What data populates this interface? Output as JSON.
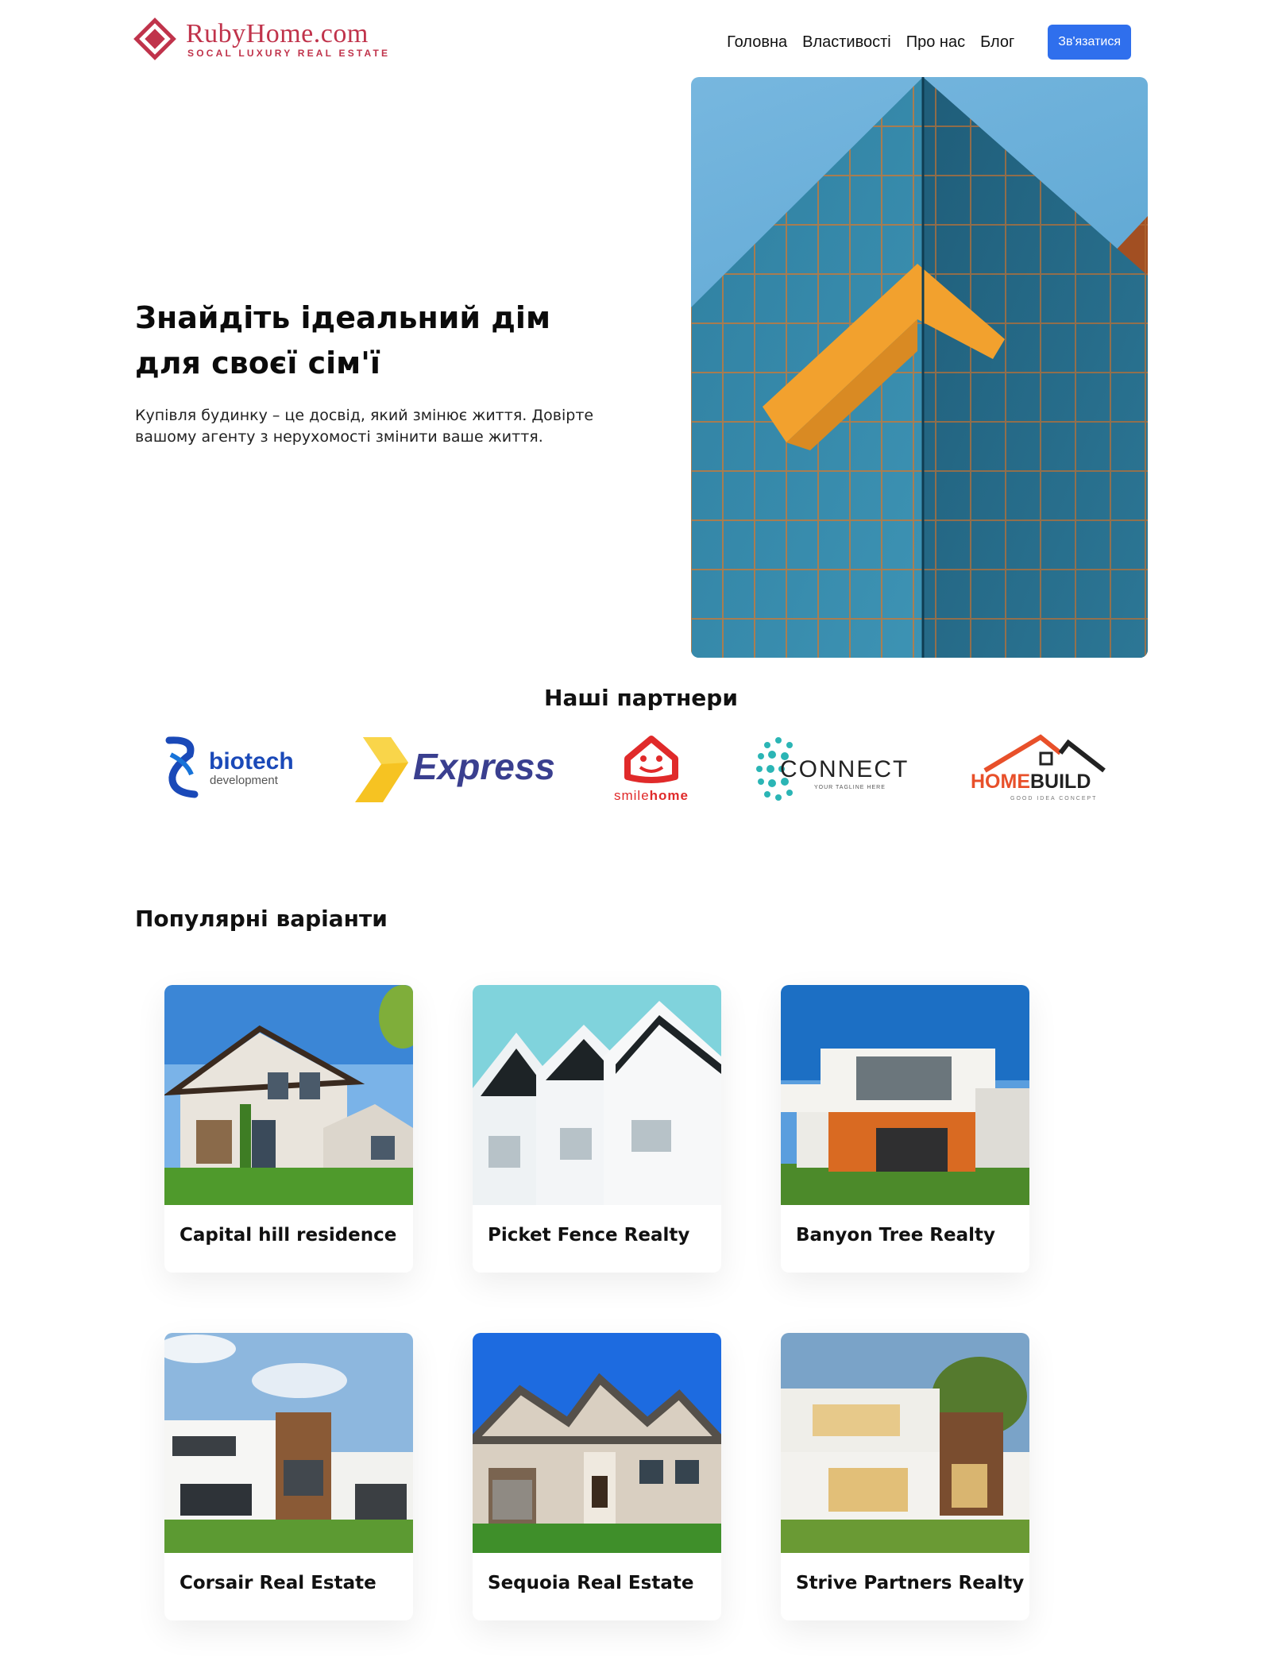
{
  "brand": {
    "name": "RubyHome.com",
    "tagline": "SOCAL LUXURY REAL ESTATE",
    "color": "#c0334b"
  },
  "nav": {
    "items": [
      "Головна",
      "Властивості",
      "Про нас",
      "Блог"
    ],
    "cta": "Зв'язатися",
    "cta_color": "#2f6fed"
  },
  "hero": {
    "title": "Знайдіть ідеальний дім для своєї сім'ї",
    "subtitle": "Купівля будинку – це досвід, який змінює життя. Довірте вашому агенту з нерухомості змінити ваше життя."
  },
  "partners": {
    "title": "Наші партнери",
    "logos": [
      {
        "name": "biotech development",
        "text_main": "biotech",
        "text_sub": "development"
      },
      {
        "name": "Express",
        "text_main": "Express"
      },
      {
        "name": "smilehome",
        "text_main": "smile",
        "text_accent": "home"
      },
      {
        "name": "CONNECT",
        "text_main": "CONNECT",
        "text_sub": "YOUR TAGLINE HERE"
      },
      {
        "name": "HOMEBUILD",
        "text_main": "HOME",
        "text_accent": "BUILD",
        "text_sub": "GOOD IDEA CONCEPT"
      }
    ]
  },
  "popular": {
    "title": "Популярні варіанти",
    "cards": [
      {
        "title": "Capital hill residence"
      },
      {
        "title": "Picket Fence Realty"
      },
      {
        "title": "Banyon Tree Realty"
      },
      {
        "title": "Corsair Real Estate"
      },
      {
        "title": "Sequoia Real Estate"
      },
      {
        "title": "Strive Partners Realty"
      }
    ]
  }
}
